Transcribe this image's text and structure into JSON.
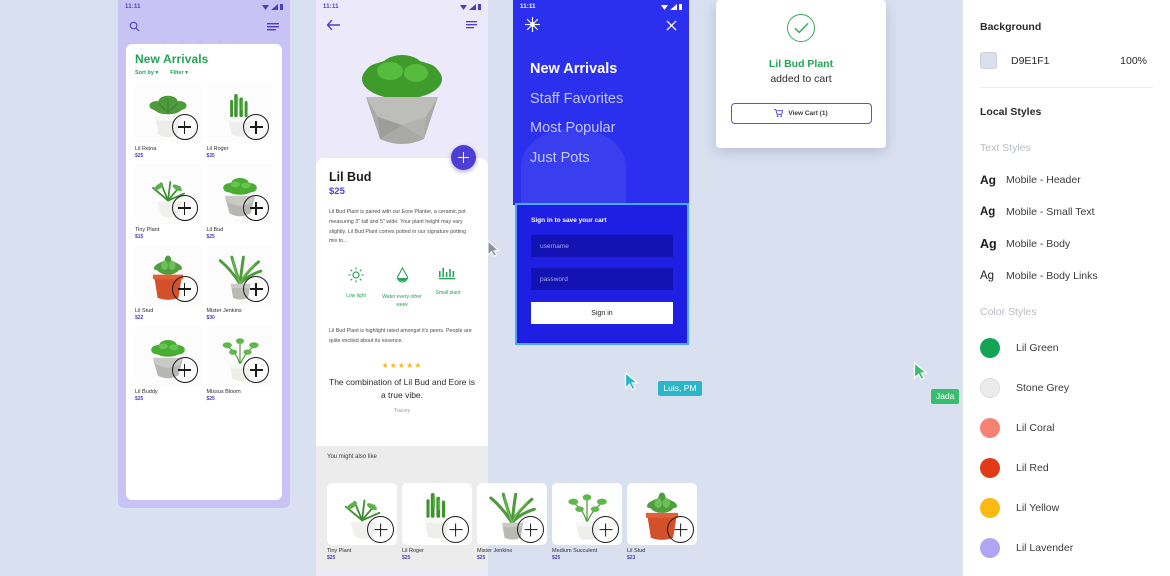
{
  "canvas": {
    "background_color": "#D9E1F1"
  },
  "mock1": {
    "name": "new-arrivals-screen",
    "status_time": "11:11",
    "search_icon": "search-icon",
    "menu_icon": "hamburger-icon",
    "section_title": "New Arrivals",
    "filters": [
      {
        "label": "Sort by"
      },
      {
        "label": "Filter"
      }
    ],
    "products": [
      {
        "name": "Lil Reina",
        "price": "$25",
        "plant": "bushy-white-pot"
      },
      {
        "name": "Lil Roger",
        "price": "$35",
        "plant": "spiky-white-pot"
      },
      {
        "name": "Tiny Plant",
        "price": "$15",
        "plant": "tiny-white-pot"
      },
      {
        "name": "Lil Bud",
        "price": "$25",
        "plant": "bud-grey-pot"
      },
      {
        "name": "Lil Stud",
        "price": "$22",
        "plant": "succulent-terracotta"
      },
      {
        "name": "Mister Jenkins",
        "price": "$30",
        "plant": "aloe-grey-pot"
      },
      {
        "name": "Lil Buddy",
        "price": "$25",
        "plant": "bud-grey-pot"
      },
      {
        "name": "Missus Bloom",
        "price": "$25",
        "plant": "bloom-white-pot"
      }
    ]
  },
  "mock2": {
    "name": "product-detail-screen",
    "status_time": "11:11",
    "back_icon": "back-arrow-icon",
    "menu_icon": "hamburger-icon",
    "fab_icon": "plus-icon",
    "title": "Lil Bud",
    "price": "$25",
    "description": "Lil Bud Plant is paired with our Eore Planter, a ceramic pot measuring 3\" tall and 5\" wide. Your plant height may vary slightly. Lil Bud Plant comes potted in our signature potting mix to...",
    "care": [
      {
        "icon": "sun-icon",
        "label": "Low light"
      },
      {
        "icon": "drop-icon",
        "label": "Water every other week"
      },
      {
        "icon": "ruler-icon",
        "label": "Small plant"
      }
    ],
    "rating_text": "Lil Bud Plant is highlight rated amongst it's peers. People are quite excited about its essence.",
    "stars": "★★★★★",
    "quote": "The combination of Lil Bud and Eore is a true vibe.",
    "author": "Tracey",
    "also_like_title": "You might also like",
    "also_like": [
      {
        "name": "Tiny Plant",
        "price": "$25",
        "plant": "tiny-white-pot"
      },
      {
        "name": "Lil Roger",
        "price": "$25",
        "plant": "spiky-white-pot"
      },
      {
        "name": "Mister Jenkins",
        "price": "$25",
        "plant": "aloe-grey-pot"
      },
      {
        "name": "Medium Succulent",
        "price": "$25",
        "plant": "bloom-white-pot"
      },
      {
        "name": "Lil Stud",
        "price": "$23",
        "plant": "succulent-terracotta"
      }
    ]
  },
  "mock3": {
    "name": "menu-screen",
    "status_time": "11:11",
    "logo_icon": "sunburst-icon",
    "close_icon": "close-icon",
    "nav": [
      {
        "label": "New Arrivals",
        "active": true
      },
      {
        "label": "Staff Favorites",
        "active": false
      },
      {
        "label": "Most Popular",
        "active": false
      },
      {
        "label": "Just Pots",
        "active": false
      }
    ]
  },
  "signin": {
    "name": "sign-in-panel",
    "title": "Sign in to save your cart",
    "username_placeholder": "username",
    "password_placeholder": "password",
    "button_label": "Sign in"
  },
  "toast": {
    "name": "added-to-cart-toast",
    "check_icon": "check-circle-icon",
    "product_name": "Lil Bud Plant",
    "subtitle": "added to cart",
    "cart_icon": "cart-icon",
    "button_label": "View Cart (1)"
  },
  "cursors": [
    {
      "label": "Luis, PM",
      "color": "#2ab5c8"
    },
    {
      "label": "Jada",
      "color": "#39bd6e"
    }
  ],
  "panel": {
    "background": {
      "heading": "Background",
      "swatch_color": "#D9E1F1",
      "hex": "D9E1F1",
      "opacity": "100%"
    },
    "local_styles": {
      "heading": "Local Styles",
      "text_styles_heading": "Text Styles",
      "text_styles": [
        {
          "preview": "Ag",
          "label": "Mobile - Header"
        },
        {
          "preview": "Ag",
          "label": "Mobile - Small Text"
        },
        {
          "preview": "Ag",
          "label": "Mobile - Body"
        },
        {
          "preview": "Ag",
          "label": "Mobile - Body Links"
        }
      ],
      "color_styles_heading": "Color Styles",
      "color_styles": [
        {
          "label": "Lil Green",
          "color": "#13a456"
        },
        {
          "label": "Stone Grey",
          "color": "#ebebeb"
        },
        {
          "label": "Lil Coral",
          "color": "#f58272"
        },
        {
          "label": "Lil Red",
          "color": "#e03a17"
        },
        {
          "label": "Lil Yellow",
          "color": "#fbb914"
        },
        {
          "label": "Lil Lavender",
          "color": "#b0a5f2"
        }
      ]
    }
  }
}
